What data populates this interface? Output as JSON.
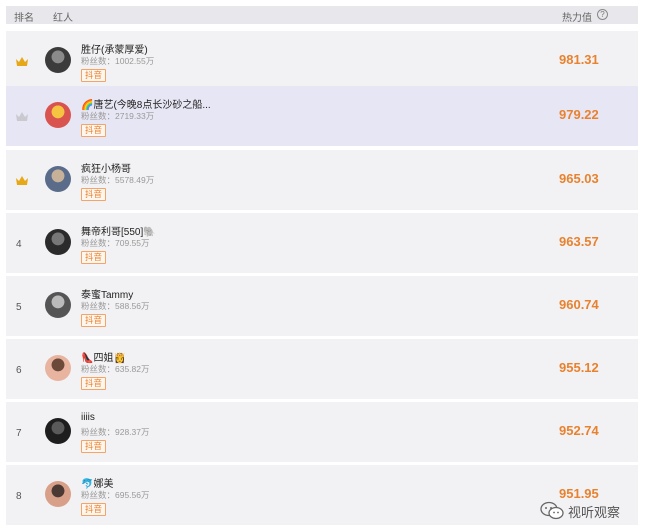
{
  "header": {
    "rank": "排名",
    "name": "红人",
    "heat": "热力值",
    "help": "?"
  },
  "fans_label": "粉丝数：",
  "colors": {
    "accent": "#e8822f",
    "crown_gold": "#e6a817",
    "crown_gray": "#c9c9cf"
  },
  "rows": [
    {
      "rank": "",
      "crown": "gold",
      "name": "胜仔(承蒙厚爱)",
      "fans": "粉丝数：1002.55万",
      "platform": "抖音",
      "heat": "981.31",
      "avatar_colors": [
        "#3b3b3b",
        "#8a8a8a"
      ]
    },
    {
      "rank": "",
      "crown": "silver",
      "name": "🌈唐艺(今晚8点长沙砂之船...",
      "fans": "粉丝数：2719.33万",
      "platform": "抖音",
      "heat": "979.22",
      "avatar_colors": [
        "#d9534f",
        "#f5c542"
      ]
    },
    {
      "rank": "",
      "crown": "bronze",
      "name": "疯狂小杨哥",
      "fans": "粉丝数：5578.49万",
      "platform": "抖音",
      "heat": "965.03",
      "avatar_colors": [
        "#5a6c8a",
        "#c7b299"
      ]
    },
    {
      "rank": "4",
      "crown": "",
      "name": "舞帝利哥[550]🐘",
      "fans": "粉丝数：709.55万",
      "platform": "抖音",
      "heat": "963.57",
      "avatar_colors": [
        "#2b2b2b",
        "#777"
      ]
    },
    {
      "rank": "5",
      "crown": "",
      "name": "泰蜜Tammy",
      "fans": "粉丝数：588.56万",
      "platform": "抖音",
      "heat": "960.74",
      "avatar_colors": [
        "#555",
        "#bbb"
      ]
    },
    {
      "rank": "6",
      "crown": "",
      "name": "👠四姐👸",
      "fans": "粉丝数：635.82万",
      "platform": "抖音",
      "heat": "955.12",
      "avatar_colors": [
        "#e8b4a0",
        "#6b4a3a"
      ]
    },
    {
      "rank": "7",
      "crown": "",
      "name": "iiiis",
      "fans": "粉丝数：928.37万",
      "platform": "抖音",
      "heat": "952.74",
      "avatar_colors": [
        "#1e1e1e",
        "#5a5a5a"
      ]
    },
    {
      "rank": "8",
      "crown": "",
      "name": "🐬娜美",
      "fans": "粉丝数：695.56万",
      "platform": "抖音",
      "heat": "951.95",
      "avatar_colors": [
        "#d8a089",
        "#4a3a33"
      ]
    }
  ],
  "watermark": {
    "text": "视听观察",
    "icon": "wechat-icon"
  }
}
